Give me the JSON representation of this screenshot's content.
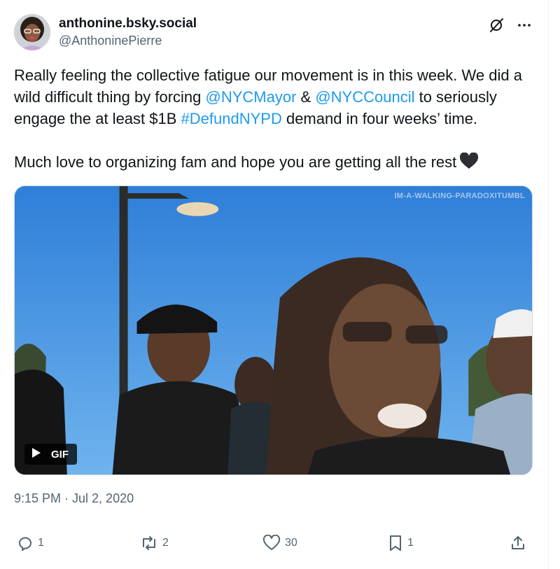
{
  "author": {
    "display_name": "anthonine.bsky.social",
    "handle": "@AnthoninePierre",
    "avatar_icon": "avatar-photo"
  },
  "header_icons": [
    "grok-icon",
    "more-icon"
  ],
  "tweet": {
    "line1": "Really feeling the collective fatigue our movement is in this week. We did a wild difficult thing by forcing ",
    "mention1": "@NYCMayor",
    "amp": " & ",
    "mention2": "@NYCCouncil",
    "line1b": " to seriously engage the at least $1B ",
    "hashtag": "#DefundNYPD",
    "line1c": " demand in four weeks’ time.",
    "line2": "Much love to organizing fam and hope you are getting all the rest"
  },
  "media": {
    "watermark": "IM-A-WALKING-PARADOXITUMBL",
    "badge_label": "GIF",
    "badge_icon": "play-icon"
  },
  "timestamp": "9:15 PM · Jul 2, 2020",
  "actions": {
    "replies": "1",
    "reposts": "2",
    "likes": "30",
    "bookmarks": "1"
  },
  "colors": {
    "link": "#1d9bf0",
    "text": "#0f1419",
    "secondary": "#536471"
  }
}
